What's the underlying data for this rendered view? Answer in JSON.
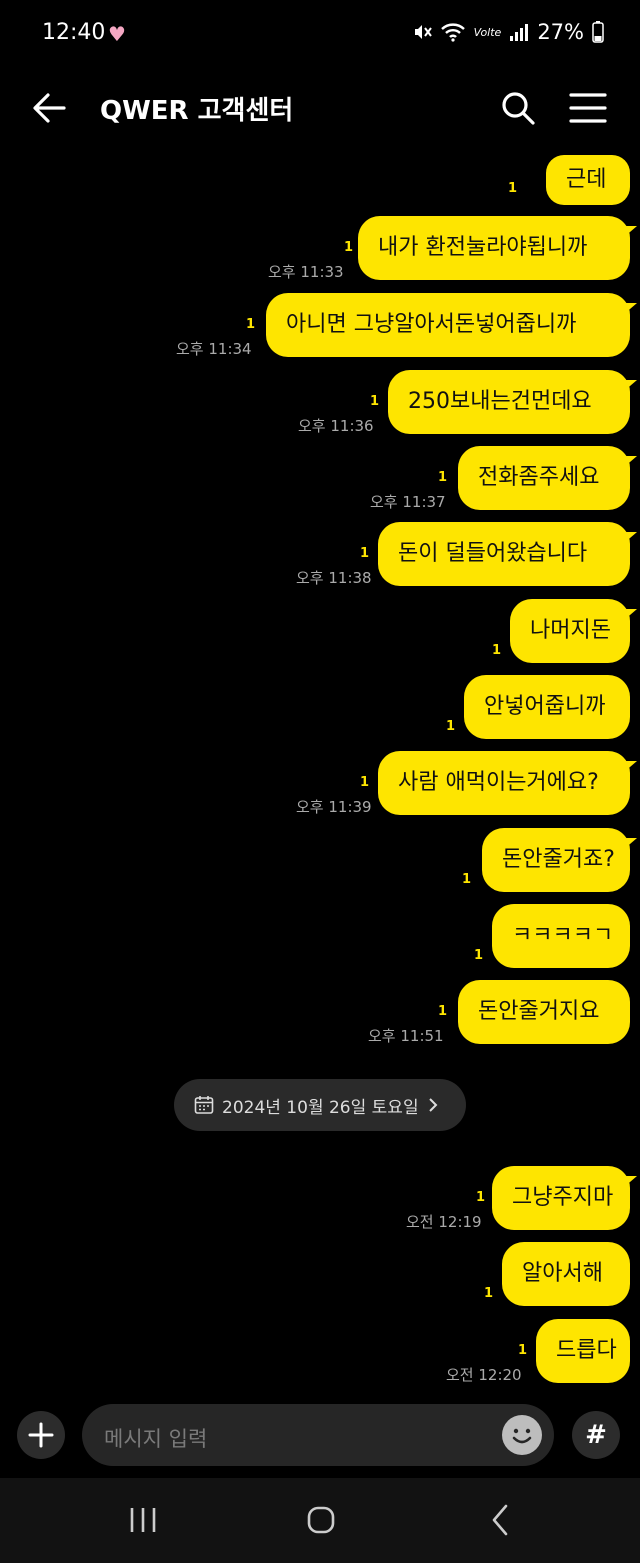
{
  "status_bar": {
    "time": "12:40",
    "battery": "27%",
    "network": "Volte",
    "signal_label": "LTE"
  },
  "header": {
    "title": "QWER 고객센터"
  },
  "messages": [
    {
      "text": "근데",
      "unread": "1"
    },
    {
      "text": "내가 환전눌라야됩니까",
      "unread": "1",
      "time": "오후 11:33"
    },
    {
      "text": "아니면 그냥알아서돈넣어줍니까",
      "unread": "1",
      "time": "오후 11:34"
    },
    {
      "text": "250보내는건먼데요",
      "unread": "1",
      "time": "오후 11:36"
    },
    {
      "text": "전화좀주세요",
      "unread": "1",
      "time": "오후 11:37"
    },
    {
      "text": "돈이 덜들어왔습니다",
      "unread": "1",
      "time": "오후 11:38"
    },
    {
      "text": "나머지돈",
      "unread": "1"
    },
    {
      "text": "안넣어줍니까",
      "unread": "1"
    },
    {
      "text": "사람 애먹이는거에요?",
      "unread": "1",
      "time": "오후 11:39"
    },
    {
      "text": "돈안줄거죠?",
      "unread": "1"
    },
    {
      "text": "ㅋㅋㅋㅋㄱ",
      "unread": "1"
    },
    {
      "text": "돈안줄거지요",
      "unread": "1",
      "time": "오후 11:51"
    },
    {
      "text": "그냥주지마",
      "unread": "1",
      "time": "오전 12:19"
    },
    {
      "text": "알아서해",
      "unread": "1"
    },
    {
      "text": "드릅다",
      "unread": "1",
      "time": "오전 12:20"
    }
  ],
  "date_divider": {
    "label": "2024년 10월 26일 토요일"
  },
  "input": {
    "placeholder": "메시지 입력"
  },
  "colors": {
    "bubble": "#fee500",
    "background": "#000000",
    "unread": "#fee500"
  }
}
